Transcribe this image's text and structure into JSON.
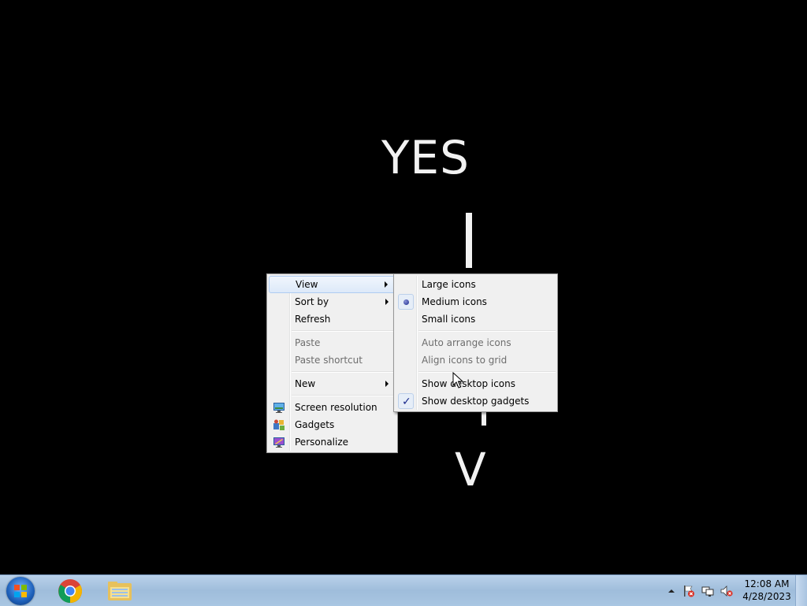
{
  "wallpaper": {
    "top_text": "YES",
    "bottom_text": "V"
  },
  "context_menu": {
    "items": [
      {
        "label": "View",
        "submenu": true,
        "highlighted": true
      },
      {
        "label": "Sort by",
        "submenu": true
      },
      {
        "label": "Refresh"
      },
      {
        "label": "Paste",
        "disabled": true
      },
      {
        "label": "Paste shortcut",
        "disabled": true
      },
      {
        "label": "New",
        "submenu": true
      },
      {
        "label": "Screen resolution",
        "icon": "screen-resolution-icon"
      },
      {
        "label": "Gadgets",
        "icon": "gadgets-icon"
      },
      {
        "label": "Personalize",
        "icon": "personalize-icon"
      }
    ]
  },
  "view_submenu": {
    "items": [
      {
        "label": "Large icons"
      },
      {
        "label": "Medium icons",
        "selected": true
      },
      {
        "label": "Small icons"
      },
      {
        "label": "Auto arrange icons",
        "disabled": true
      },
      {
        "label": "Align icons to grid",
        "disabled": true
      },
      {
        "label": "Show desktop icons",
        "checked": false
      },
      {
        "label": "Show desktop gadgets",
        "checked": true
      }
    ]
  },
  "taskbar": {
    "pinned": [
      "start-orb-icon",
      "chrome-icon",
      "windows-explorer-icon"
    ],
    "tray_icons": [
      "show-hidden-icons-icon",
      "action-center-icon",
      "network-icon",
      "volume-muted-icon"
    ],
    "clock": {
      "time": "12:08 AM",
      "date": "4/28/2023"
    }
  },
  "colors": {
    "desktop_background": "#000000",
    "menu_background": "#f0f0f0",
    "menu_highlight_border": "#aeccf1",
    "taskbar": "#a9c6e2"
  }
}
